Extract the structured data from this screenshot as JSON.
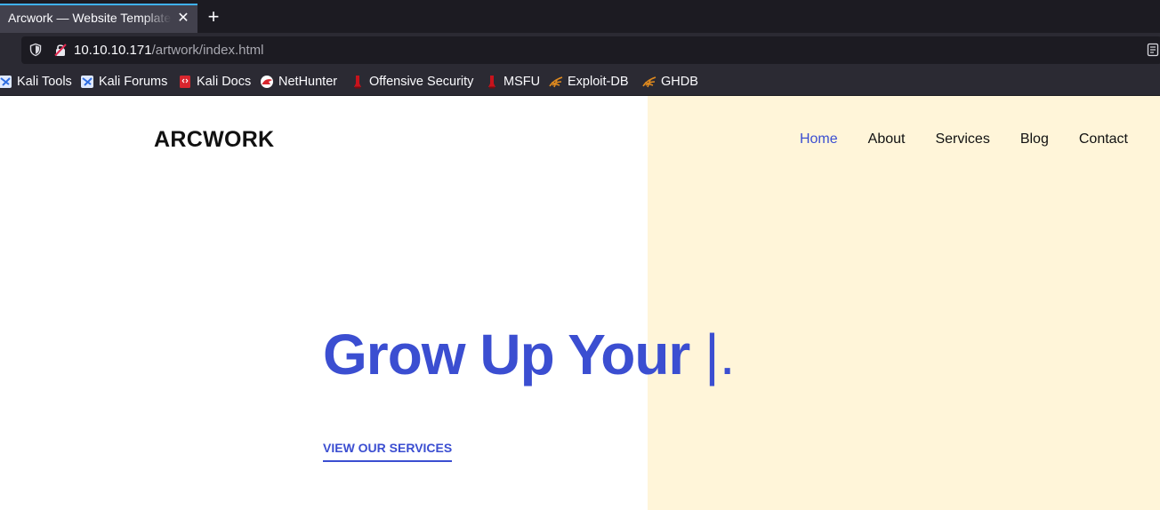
{
  "browser": {
    "tab": {
      "title": "Arcwork — Website Template",
      "close_glyph": "✕"
    },
    "new_tab_glyph": "+",
    "url": {
      "host": "10.10.10.171",
      "path": "/artwork/index.html"
    },
    "icons": {
      "tracking": "shield-icon",
      "security": "insecure-lock-icon",
      "reader": "reader-view-icon"
    },
    "bookmarks": [
      {
        "label": "Kali Tools",
        "icon": "kali-dragon-icon"
      },
      {
        "label": "Kali Forums",
        "icon": "kali-dragon-icon"
      },
      {
        "label": "Kali Docs",
        "icon": "kali-docs-icon"
      },
      {
        "label": "NetHunter",
        "icon": "nethunter-icon"
      },
      {
        "label": "Offensive Security",
        "icon": "offsec-icon"
      },
      {
        "label": "MSFU",
        "icon": "offsec-icon"
      },
      {
        "label": "Exploit-DB",
        "icon": "exploitdb-icon"
      },
      {
        "label": "GHDB",
        "icon": "exploitdb-icon"
      }
    ]
  },
  "site": {
    "logo": "ARCWORK",
    "nav": [
      {
        "label": "Home",
        "active": true
      },
      {
        "label": "About",
        "active": false
      },
      {
        "label": "Services",
        "active": false
      },
      {
        "label": "Blog",
        "active": false
      },
      {
        "label": "Contact",
        "active": false
      }
    ],
    "hero": {
      "headline": "Grow Up Your ",
      "cursor": "|.",
      "cta": "VIEW OUR SERVICES"
    }
  },
  "colors": {
    "accent": "#3b4ed1",
    "hero_bg": "#fff5d9",
    "chrome_dark": "#1c1b22",
    "chrome_mid": "#2b2a33",
    "tab_active": "#42414d"
  }
}
